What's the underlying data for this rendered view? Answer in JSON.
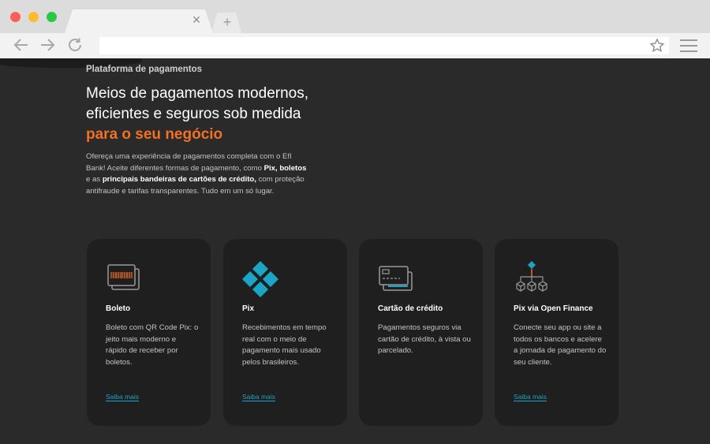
{
  "browser": {
    "tab_close": "×",
    "new_tab": "+",
    "url": ""
  },
  "hero": {
    "eyebrow": "Plataforma de pagamentos",
    "headline_line1": "Meios de pagamentos modernos,",
    "headline_line2": "eficientes e seguros sob medida",
    "headline_accent": "para o seu negócio",
    "intro_part1": "Ofereça uma experiência de pagamentos completa com o Efí Bank! Aceite diferentes formas de pagamento, como ",
    "intro_bold1": "Pix, boletos",
    "intro_part2": " e as ",
    "intro_bold2": "principais bandeiras de cartões de crédito,",
    "intro_part3": " com proteção antifraude e tarifas transparentes. Tudo em um só lugar."
  },
  "colors": {
    "accent_orange": "#f37021",
    "accent_teal": "#1aa5c6",
    "card_bg": "#1f1f1f",
    "page_bg": "#2a2a2a"
  },
  "cards": [
    {
      "icon": "boleto-icon",
      "title": "Boleto",
      "description": "Boleto com QR Code Pix: o jeito mais moderno e rápido de receber por boletos.",
      "link": "Saiba mais"
    },
    {
      "icon": "pix-icon",
      "title": "Pix",
      "description": "Recebimentos em tempo real com o meio de pagamento mais usado pelos brasileiros.",
      "link": "Saiba mais"
    },
    {
      "icon": "credit-card-icon",
      "title": "Cartão de crédito",
      "description": "Pagamentos seguros via cartão de crédito, à vista ou parcelado.",
      "link": ""
    },
    {
      "icon": "open-finance-icon",
      "title": "Pix via Open Finance",
      "description": "Conecte seu app ou site a todos os bancos e acelere a jornada de pagamento do seu cliente.",
      "link": "Saiba mais"
    }
  ]
}
